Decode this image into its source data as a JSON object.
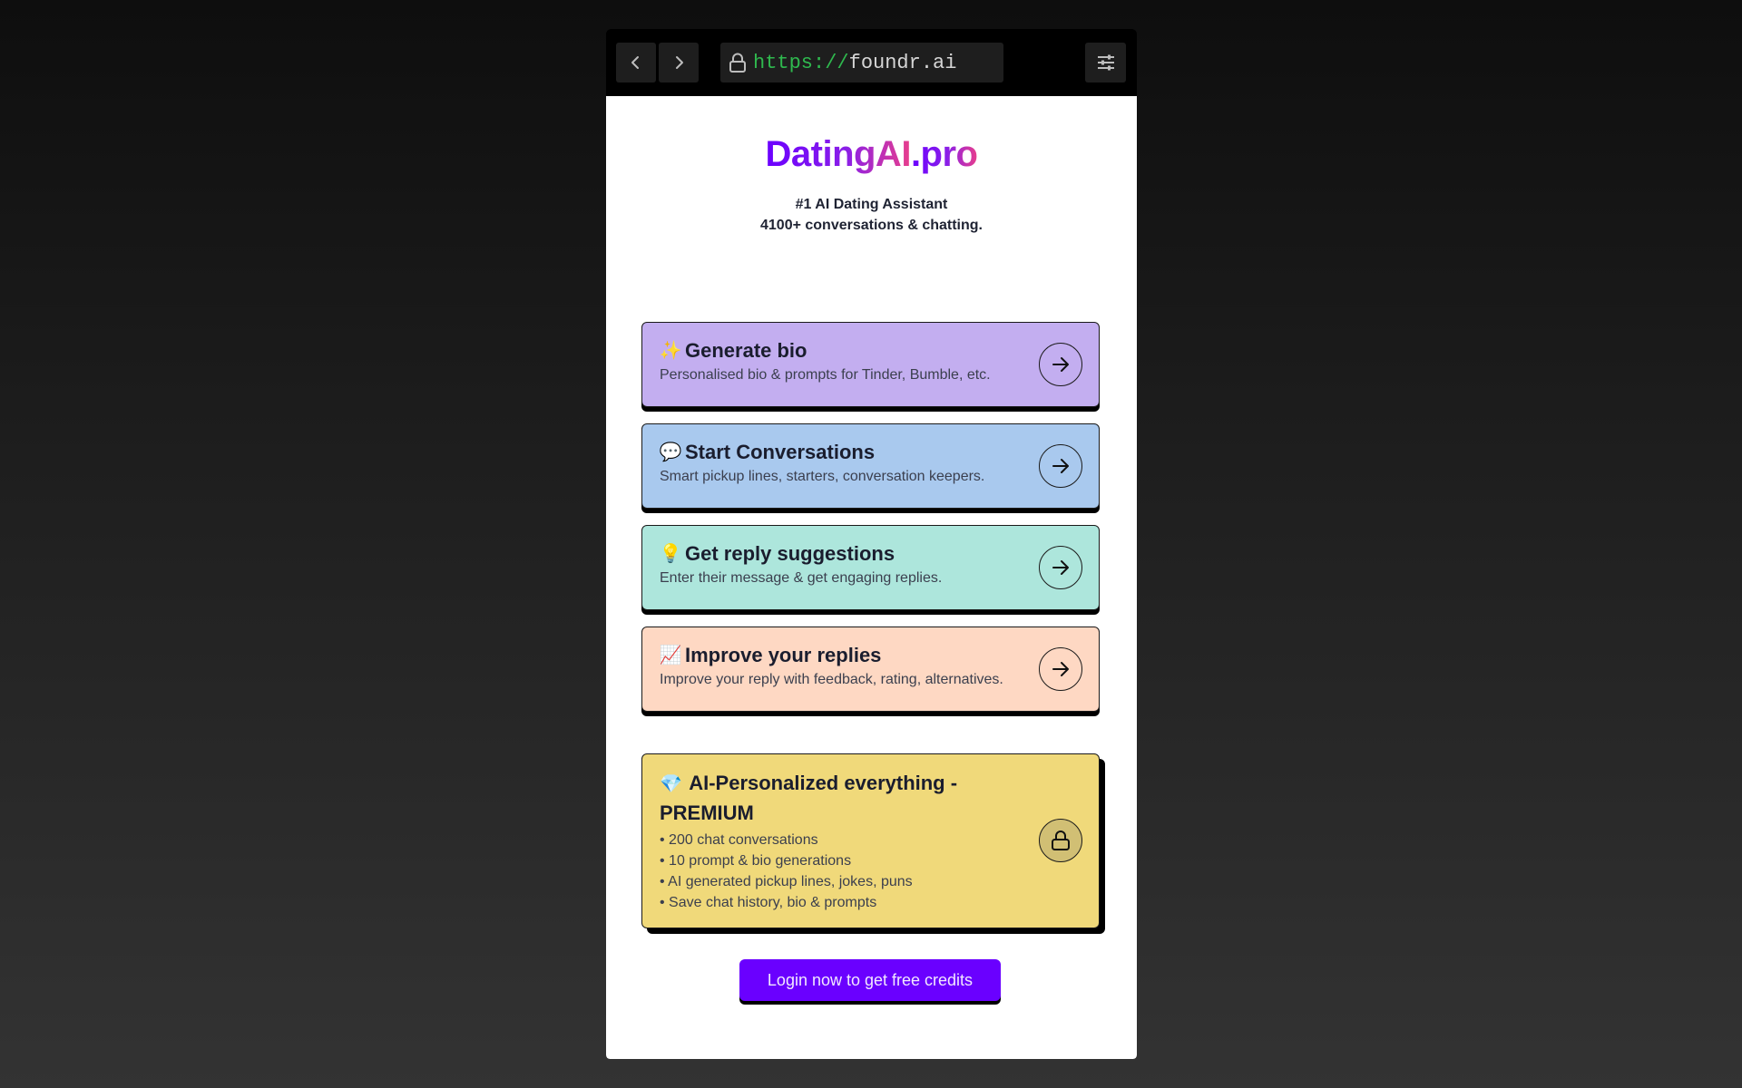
{
  "browser": {
    "url_scheme": "https://",
    "url_host": "foundr.ai",
    "icons": {
      "back": "chevron-left-icon",
      "forward": "chevron-right-icon",
      "lock": "lock-icon",
      "settings": "sliders-icon"
    }
  },
  "header": {
    "brand_main": "DatingAI",
    "brand_suffix": ".pro",
    "tagline_line1": "#1 AI Dating Assistant",
    "tagline_line2": "4100+ conversations & chatting."
  },
  "features": [
    {
      "emoji": "✨",
      "icon": "sparkles-icon",
      "title": "Generate bio",
      "description": "Personalised bio & prompts for Tinder, Bumble, etc.",
      "color": "#c3aef0"
    },
    {
      "emoji": "💬",
      "icon": "speech-bubble-icon",
      "title": "Start Conversations",
      "description": "Smart pickup lines, starters, conversation keepers.",
      "color": "#a9c9ee"
    },
    {
      "emoji": "💡",
      "icon": "light-bulb-icon",
      "title": "Get reply suggestions",
      "description": "Enter their message & get engaging replies.",
      "color": "#ade6dc"
    },
    {
      "emoji": "📈",
      "icon": "chart-increasing-icon",
      "title": "Improve your replies",
      "description": "Improve your reply with feedback, rating, alternatives.",
      "color": "#fed8c3"
    }
  ],
  "premium": {
    "emoji": "💎",
    "icon": "gem-icon",
    "title": "AI-Personalized everything - PREMIUM",
    "items": [
      "• 200 chat conversations",
      "• 10 prompt & bio generations",
      "• AI generated pickup lines, jokes, puns",
      "• Save chat history, bio & prompts"
    ],
    "color": "#f0d97a",
    "locked_icon": "lock-icon"
  },
  "cta": {
    "login_label": "Login now to get free credits",
    "color": "#6a00ff"
  }
}
